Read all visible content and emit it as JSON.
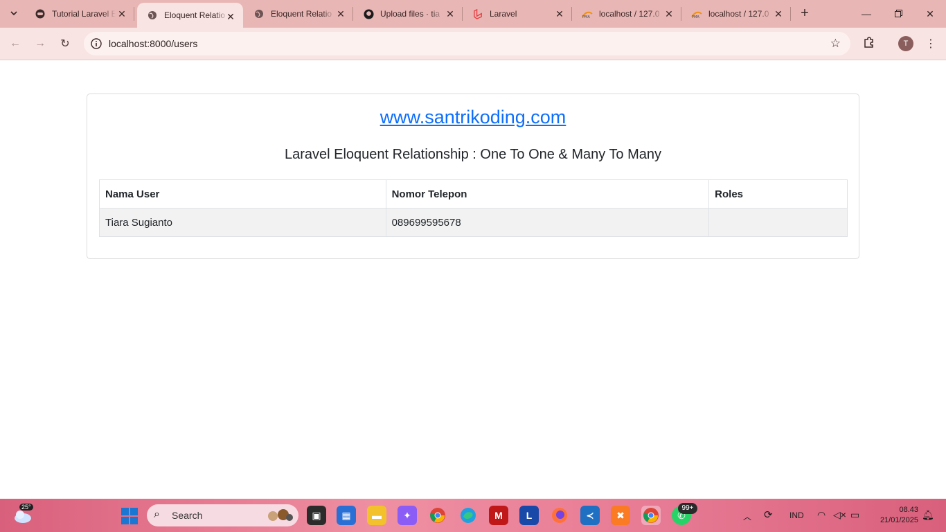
{
  "browser": {
    "tabs": [
      {
        "title": "Tutorial Laravel E",
        "icon": "tab-favicon-icon"
      },
      {
        "title": "Eloquent Relatio",
        "icon": "globe-icon",
        "active": true
      },
      {
        "title": "Eloquent Relatio",
        "icon": "globe-icon"
      },
      {
        "title": "Upload files · tia",
        "icon": "github-icon"
      },
      {
        "title": "Laravel",
        "icon": "laravel-icon"
      },
      {
        "title": "localhost / 127.0",
        "icon": "phpmyadmin-icon"
      },
      {
        "title": "localhost / 127.0",
        "icon": "phpmyadmin-icon"
      }
    ],
    "url": "localhost:8000/users",
    "profile_initial": "T"
  },
  "page": {
    "site_link": "www.santrikoding.com",
    "subtitle": "Laravel Eloquent Relationship : One To One & Many To Many",
    "table": {
      "headers": [
        "Nama User",
        "Nomor Telepon",
        "Roles"
      ],
      "rows": [
        [
          "Tiara Sugianto",
          "089699595678",
          ""
        ]
      ]
    }
  },
  "taskbar": {
    "weather_temp": "25°",
    "search_label": "Search",
    "whatsapp_badge": "99+",
    "language": "IND",
    "time": "08.43",
    "date": "21/01/2025"
  },
  "colors": {
    "titlebar": "#e8b7b5",
    "toolbar": "#f8e4e2",
    "link": "#0d6efd",
    "taskbar": "#e77a94"
  }
}
